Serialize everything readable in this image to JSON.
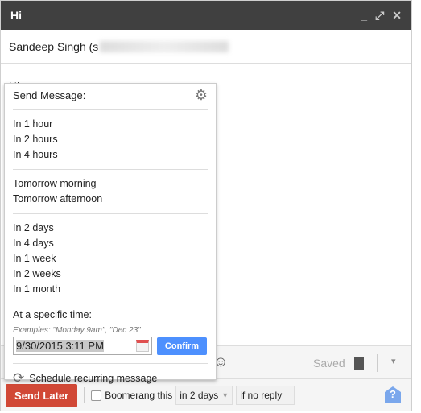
{
  "window": {
    "title": "Hi",
    "minimize": "_",
    "expand": "⤢",
    "close": "✕"
  },
  "recipient": {
    "name": "Sandeep Singh (s"
  },
  "subject": "Hi",
  "toolbar": {
    "saved": "Saved",
    "emoji": "☺",
    "trash": "🗑",
    "more": "▾"
  },
  "bottom": {
    "send_later": "Send Later",
    "boomerang_label": "Boomerang this",
    "delay": "in 2 days",
    "condition": "if no reply",
    "help": "?"
  },
  "popup": {
    "title": "Send Message:",
    "groups": [
      [
        "In 1 hour",
        "In 2 hours",
        "In 4 hours"
      ],
      [
        "Tomorrow morning",
        "Tomorrow afternoon"
      ],
      [
        "In 2 days",
        "In 4 days",
        "In 1 week",
        "In 2 weeks",
        "In 1 month"
      ]
    ],
    "specific_label": "At a specific time:",
    "examples": "Examples: \"Monday 9am\", \"Dec 23\"",
    "datetime_value": "9/30/2015 3:11 PM",
    "confirm": "Confirm",
    "recurring": "Schedule recurring message"
  },
  "colors": {
    "send_later": "#d14836",
    "confirm": "#4d90fe",
    "header": "#404040"
  }
}
